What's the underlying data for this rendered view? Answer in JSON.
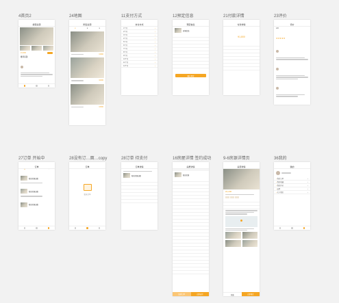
{
  "boards": [
    {
      "id": "home",
      "label": "4首页2"
    },
    {
      "id": "nearby",
      "label": "24地图"
    },
    {
      "id": "payment",
      "label": "11支付方式"
    },
    {
      "id": "contract",
      "label": "12预定信息"
    },
    {
      "id": "booked",
      "label": "21付款详情"
    },
    {
      "id": "review",
      "label": "23评价"
    },
    {
      "id": "orders",
      "label": "27订单 开始中"
    },
    {
      "id": "empty",
      "label": "28没有订…面…copy"
    },
    {
      "id": "pending",
      "label": "28订单 待支付"
    },
    {
      "id": "booking",
      "label": "16房屋详情 签约成功"
    },
    {
      "id": "detail",
      "label": "9-6房源详情页"
    },
    {
      "id": "mine",
      "label": "36我的"
    }
  ],
  "phones": {
    "home": {
      "title": "搜索房源",
      "price": "¥1,500",
      "section": "推荐房源"
    },
    "nearby": {
      "title": "附近房源",
      "prices": [
        "¥1800",
        "¥2000",
        "¥1500"
      ]
    },
    "payment": {
      "title": "支付方式",
      "items": [
        "1个月",
        "2个月",
        "3个月",
        "4个月",
        "5个月",
        "6个月",
        "7个月",
        "8个月",
        "9个月",
        "10个月",
        "11个月",
        "12个月"
      ]
    },
    "contract": {
      "title": "预定信息",
      "room": "房源信息",
      "button": "确认预定"
    },
    "booked": {
      "title": "付款详情",
      "amount": "¥1,800"
    },
    "review": {
      "title": "评价",
      "score": "4.8"
    },
    "orders": {
      "title": "订单",
      "items": [
        "新房房源出租",
        "新房房源出租",
        "新房房源出租"
      ]
    },
    "empty": {
      "title": "订单",
      "empty_text": "暂无订单"
    },
    "pending": {
      "title": "订单详情",
      "room": "新房房源出租"
    },
    "booking": {
      "title": "房屋详情",
      "room": "新房房源",
      "left_btn": "取消订单",
      "right_btn": "立即支付"
    },
    "detail": {
      "title": "房源详情",
      "price": "¥2,200",
      "left_btn": "收藏",
      "right_btn": "立即预定"
    },
    "mine": {
      "title": "我的",
      "menu": [
        "我的订单",
        "我的收藏",
        "我的评价",
        "设置",
        "关于我们"
      ]
    }
  },
  "colors": {
    "accent": "#f5a623",
    "bg": "#f2f2f2"
  }
}
